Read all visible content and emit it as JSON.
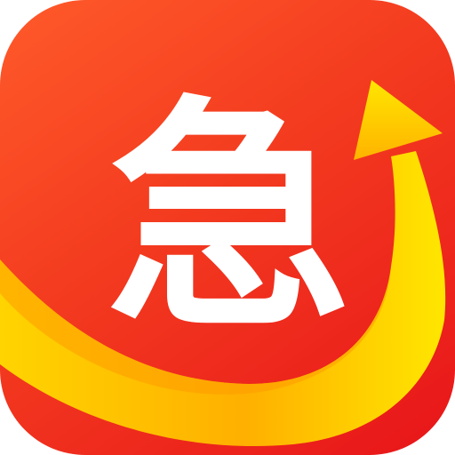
{
  "app_icon": {
    "glyph": "急",
    "colors": {
      "background_top": "#ff5a2a",
      "background_bottom": "#e8151a",
      "swoosh_light": "#ffe600",
      "swoosh_dark": "#ff9f00",
      "glyph": "#ffffff"
    },
    "icons": [
      "rising-arrow-icon",
      "swoosh-icon"
    ]
  }
}
